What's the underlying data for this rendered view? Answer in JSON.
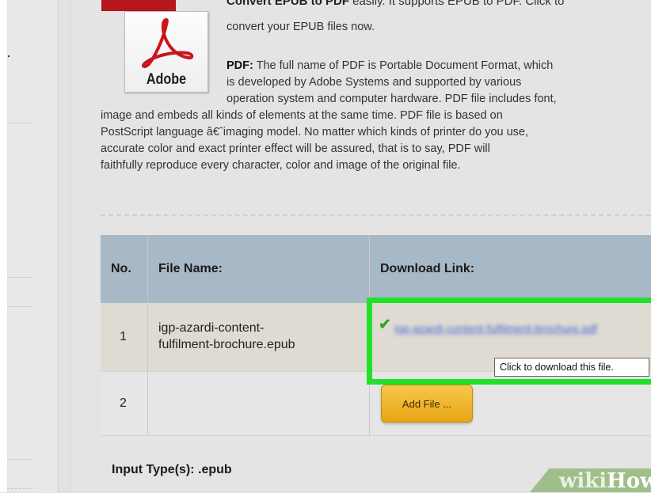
{
  "header": {
    "headline_bold": "Convert EPUB to PDF",
    "headline_tail": " easily. It supports EPUB to PDF. Click to",
    "line2": "convert your EPUB files now."
  },
  "logo": {
    "text": "Adobe"
  },
  "description": {
    "label": "PDF:",
    "line1": " The full name of PDF is Portable Document Format, which",
    "line2": "is developed by Adobe Systems and supported by various",
    "line3": "operation system and computer hardware. PDF file includes font,",
    "line4": "image and embeds all kinds of elements at the same time. PDF file is based on",
    "line5": "PostScript language â€ˆimaging model. No matter which kinds of printer do you use,",
    "line6": "accurate color and exact printer effect will be assured, that is to say, PDF will",
    "line7": "faithfully reproduce every character, color and image of the original file."
  },
  "table": {
    "headers": {
      "no": "No.",
      "file_name": "File Name:",
      "download": "Download Link:"
    },
    "rows": [
      {
        "no": "1",
        "file_line1": "igp-azardi-content-",
        "file_line2": "fulfilment-brochure.epub",
        "link_text": "igp-azardi-content-fulfilment-brochure.pdf"
      },
      {
        "no": "2",
        "file_line1": "",
        "file_line2": "",
        "button": "Add File ..."
      }
    ],
    "footer": "Input Type(s): .epub"
  },
  "tooltip": "Click to download this file.",
  "icons": {
    "check": "check-icon",
    "logo": "adobe-pdf-logo"
  },
  "colors": {
    "header_bg": "#a7b8c7",
    "row1_bg": "#e0dbd2",
    "highlight": "#22e02a",
    "button": "#efb12b",
    "link": "#4a6ad8"
  },
  "watermark": {
    "part1": "wiki",
    "part2": "How"
  }
}
